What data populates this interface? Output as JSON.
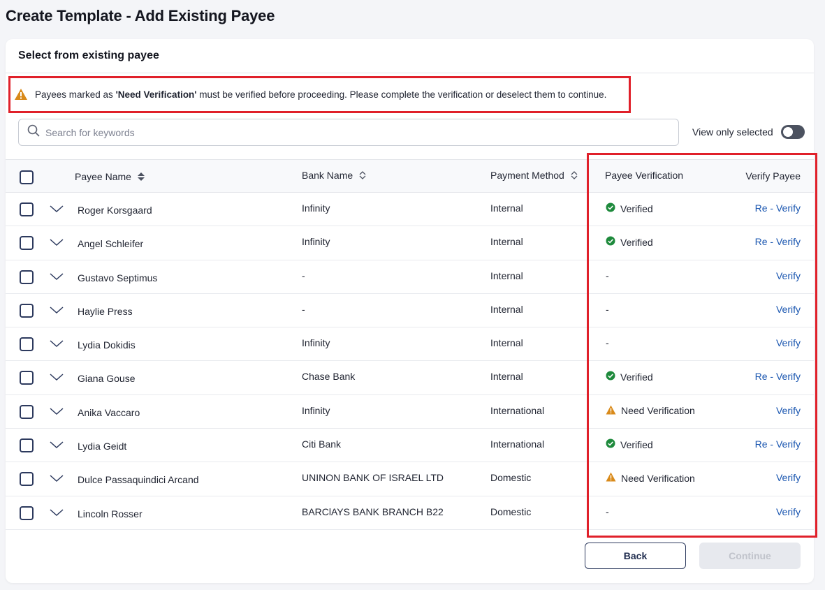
{
  "page_title": "Create Template - Add Existing Payee",
  "card_title": "Select from existing payee",
  "alert": {
    "prefix": "Payees marked as ",
    "emphasis": "'Need Verification'",
    "suffix": " must be verified before proceeding. Please complete the verification or deselect them to continue."
  },
  "search": {
    "placeholder": "Search for keywords",
    "value": ""
  },
  "view_only_selected": {
    "label": "View only selected",
    "on": false
  },
  "columns": {
    "payee_name": "Payee Name",
    "bank_name": "Bank Name",
    "payment_method": "Payment Method",
    "payee_verification": "Payee Verification",
    "verify_payee": "Verify Payee"
  },
  "rows": [
    {
      "name": "Roger Korsgaard",
      "bank": "Infinity",
      "method": "Internal",
      "verification": "Verified",
      "status": "verified",
      "action": "Re - Verify"
    },
    {
      "name": "Angel Schleifer",
      "bank": "Infinity",
      "method": "Internal",
      "verification": "Verified",
      "status": "verified",
      "action": "Re - Verify"
    },
    {
      "name": "Gustavo Septimus",
      "bank": "-",
      "method": "Internal",
      "verification": "-",
      "status": "none",
      "action": "Verify"
    },
    {
      "name": "Haylie Press",
      "bank": "-",
      "method": "Internal",
      "verification": "-",
      "status": "none",
      "action": "Verify"
    },
    {
      "name": "Lydia Dokidis",
      "bank": "Infinity",
      "method": "Internal",
      "verification": "-",
      "status": "none",
      "action": "Verify"
    },
    {
      "name": "Giana Gouse",
      "bank": "Chase Bank",
      "method": "Internal",
      "verification": "Verified",
      "status": "verified",
      "action": "Re - Verify"
    },
    {
      "name": "Anika Vaccaro",
      "bank": "Infinity",
      "method": "International",
      "verification": "Need Verification",
      "status": "warning",
      "action": "Verify"
    },
    {
      "name": "Lydia Geidt",
      "bank": "Citi Bank",
      "method": "International",
      "verification": "Verified",
      "status": "verified",
      "action": "Re - Verify"
    },
    {
      "name": "Dulce Passaquindici Arcand",
      "bank": "UNINON BANK OF ISRAEL LTD",
      "method": "Domestic",
      "verification": "Need Verification",
      "status": "warning",
      "action": "Verify"
    },
    {
      "name": "Lincoln Rosser",
      "bank": "BARClAYS BANK BRANCH B22",
      "method": "Domestic",
      "verification": "-",
      "status": "none",
      "action": "Verify"
    }
  ],
  "buttons": {
    "back": "Back",
    "continue": "Continue"
  },
  "colors": {
    "highlight": "#e0202a",
    "link": "#1a56b0",
    "verified": "#1e8a3c",
    "warning": "#d98a1a",
    "primary_dark": "#2d3a5e"
  }
}
